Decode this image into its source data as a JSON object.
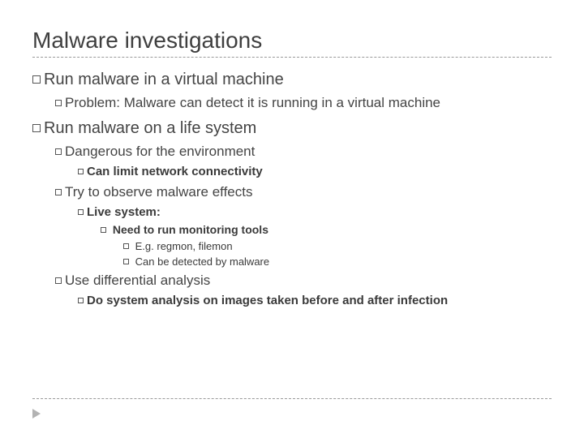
{
  "title": "Malware investigations",
  "b1": {
    "lead": "Run",
    "rest": " malware in a virtual machine"
  },
  "b1a": {
    "lead": "Problem:",
    "rest": " Malware can detect it is running in a virtual machine"
  },
  "b2": {
    "lead": "Run",
    "rest": " malware on a life system"
  },
  "b2a": {
    "lead": "Dangerous",
    "rest": " for the environment"
  },
  "b2a1": {
    "lead": "Can",
    "rest": " limit network connectivity"
  },
  "b2b": {
    "lead": "Try",
    "rest": " to observe malware effects"
  },
  "b2b1": {
    "lead": "Live",
    "rest": " system:"
  },
  "b2b1a": "Need to run monitoring tools",
  "b2b1a1": "E.g. regmon, filemon",
  "b2b1a2": "Can be detected by malware",
  "b2c": {
    "lead": "Use",
    "rest": " differential analysis"
  },
  "b2c1": {
    "lead": "Do",
    "rest": " system analysis on images taken before and after infection"
  }
}
